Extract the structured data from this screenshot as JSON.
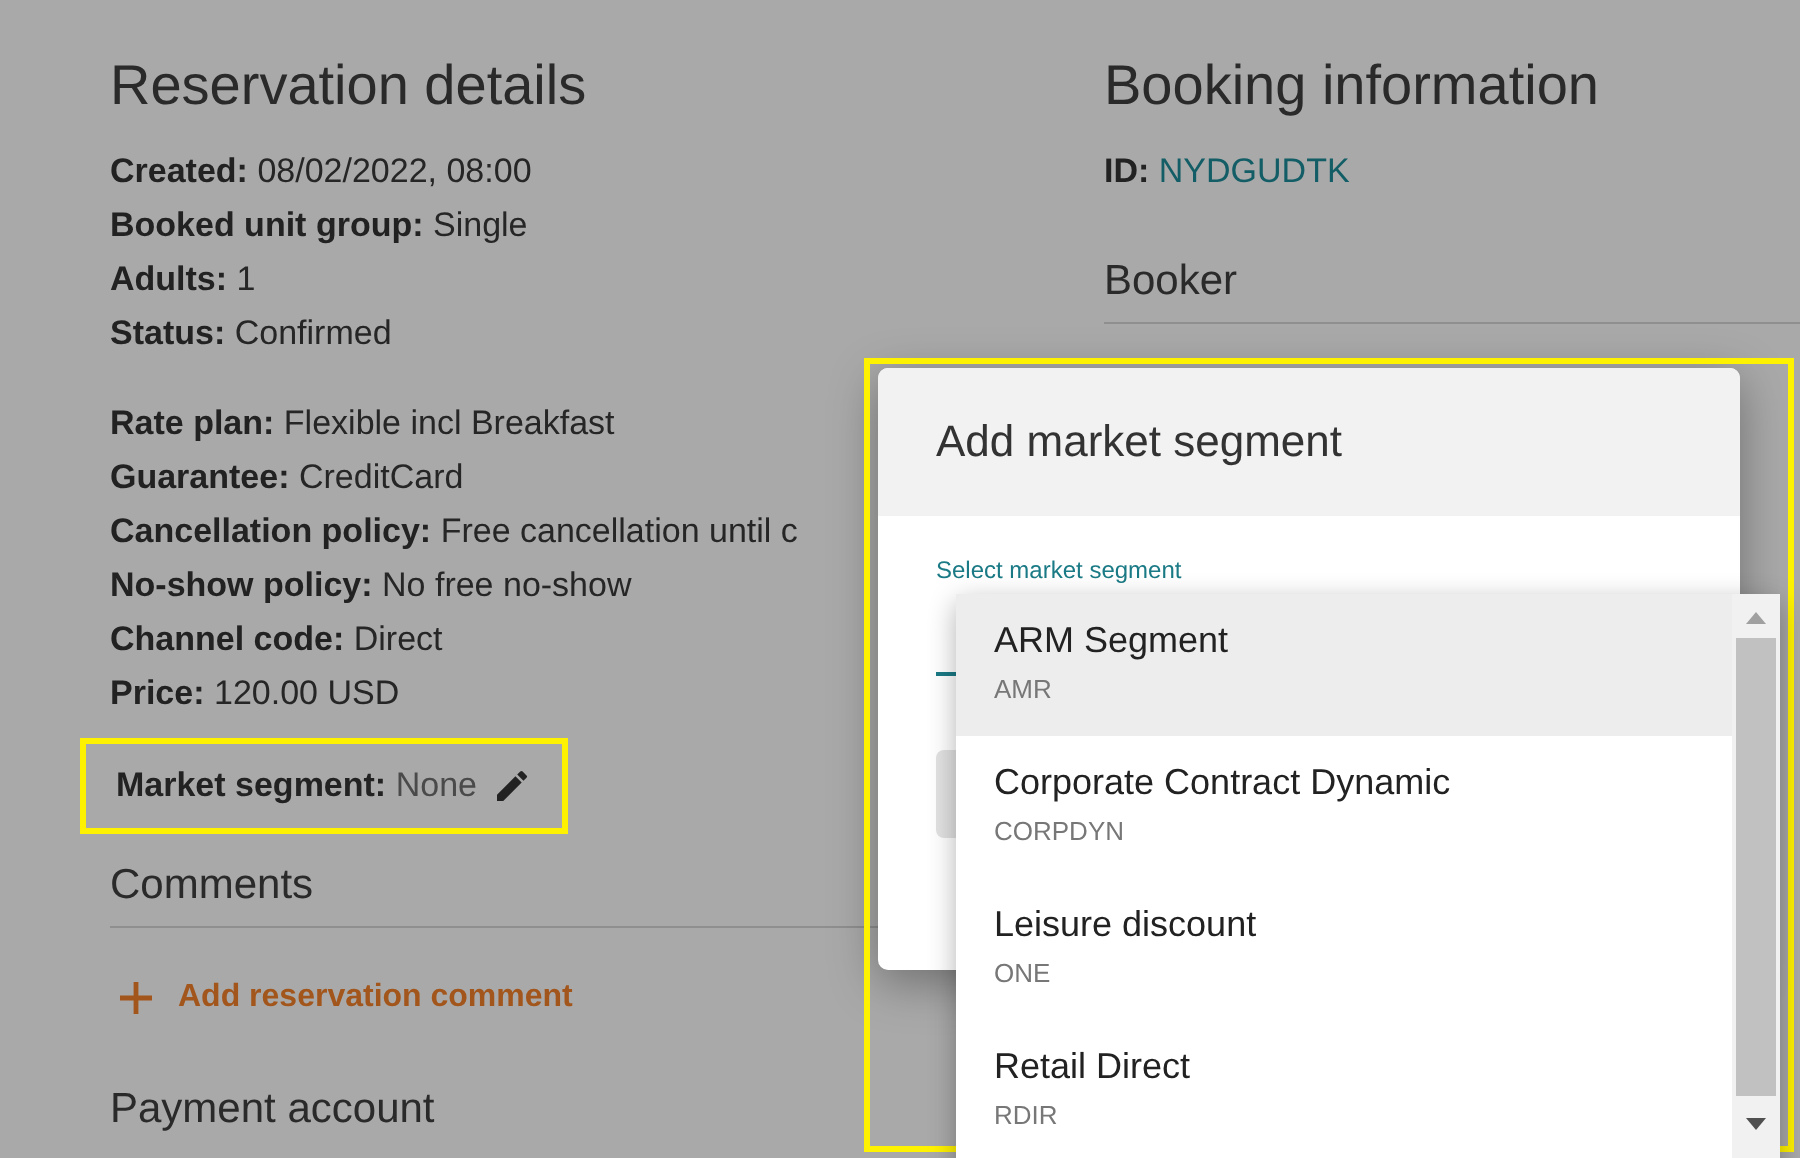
{
  "reservation": {
    "title": "Reservation details",
    "groups": [
      [
        {
          "label": "Created:",
          "value": "08/02/2022, 08:00"
        },
        {
          "label": "Booked unit group:",
          "value": "Single"
        },
        {
          "label": "Adults:",
          "value": "1"
        },
        {
          "label": "Status:",
          "value": "Confirmed"
        }
      ],
      [
        {
          "label": "Rate plan:",
          "value": "Flexible incl Breakfast"
        },
        {
          "label": "Guarantee:",
          "value": "CreditCard"
        },
        {
          "label": "Cancellation policy:",
          "value": "Free cancellation until c"
        },
        {
          "label": "No-show policy:",
          "value": "No free no-show"
        },
        {
          "label": "Channel code:",
          "value": "Direct"
        },
        {
          "label": "Price:",
          "value": "120.00 USD"
        }
      ]
    ],
    "market_segment": {
      "label": "Market segment:",
      "value": "None",
      "highlighted": true
    },
    "comments": {
      "title": "Comments",
      "add_label": "Add reservation comment"
    },
    "payment_title": "Payment account"
  },
  "booking": {
    "title": "Booking information",
    "id_label": "ID:",
    "id_value": "NYDGUDTK",
    "booker_title": "Booker"
  },
  "dialog": {
    "title": "Add market segment",
    "field_label": "Select market segment",
    "highlighted": true,
    "options": [
      {
        "name": "ARM Segment",
        "code": "AMR",
        "selected": true
      },
      {
        "name": "Corporate Contract Dynamic",
        "code": "CORPDYN",
        "selected": false
      },
      {
        "name": "Leisure discount",
        "code": "ONE",
        "selected": false
      },
      {
        "name": "Retail Direct",
        "code": "RDIR",
        "selected": false
      }
    ]
  }
}
